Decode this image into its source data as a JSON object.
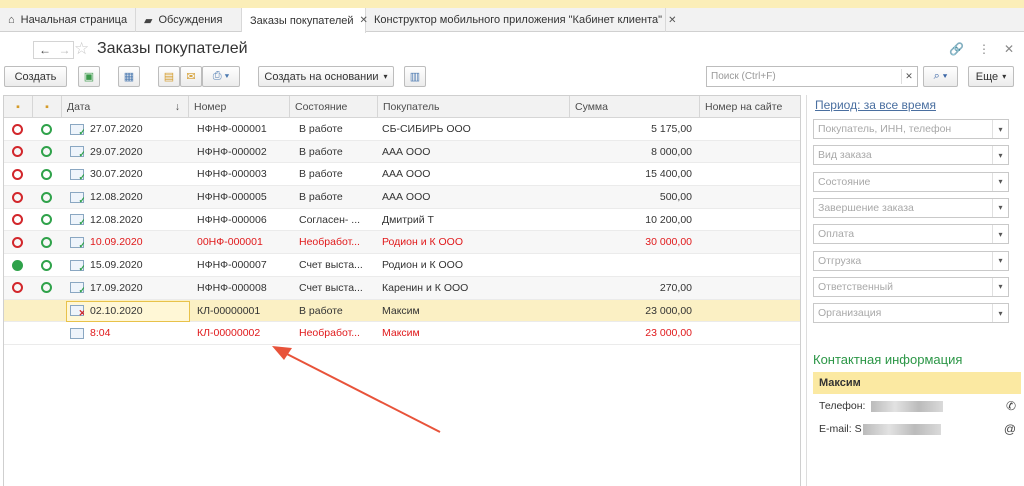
{
  "tabs": [
    {
      "label": "Начальная страница",
      "icon": "home-icon"
    },
    {
      "label": "Обсуждения",
      "icon": "chat-icon"
    },
    {
      "label": "Заказы покупателей",
      "active": true
    },
    {
      "label": "Конструктор мобильного приложения \"Кабинет клиента\""
    }
  ],
  "header": {
    "title": "Заказы покупателей"
  },
  "toolbar": {
    "create": "Создать",
    "create_based": "Создать на основании",
    "more": "Еще",
    "search_placeholder": "Поиск (Ctrl+F)"
  },
  "columns": {
    "date": "Дата",
    "sort_arrow": "↓",
    "number": "Номер",
    "state": "Состояние",
    "buyer": "Покупатель",
    "sum": "Сумма",
    "site_number": "Номер на сайте"
  },
  "rows": [
    {
      "date": "27.07.2020",
      "number": "НФНФ-000001",
      "state": "В работе",
      "buyer": "СБ-СИБИРЬ ООО",
      "sum": "5 175,00"
    },
    {
      "date": "29.07.2020",
      "number": "НФНФ-000002",
      "state": "В работе",
      "buyer": "ААА ООО",
      "sum": "8 000,00"
    },
    {
      "date": "30.07.2020",
      "number": "НФНФ-000003",
      "state": "В работе",
      "buyer": "ААА ООО",
      "sum": "15 400,00"
    },
    {
      "date": "12.08.2020",
      "number": "НФНФ-000005",
      "state": "В работе",
      "buyer": "ААА ООО",
      "sum": "500,00"
    },
    {
      "date": "12.08.2020",
      "number": "НФНФ-000006",
      "state": "Согласен- ...",
      "buyer": "Дмитрий Т",
      "sum": "10 200,00"
    },
    {
      "date": "10.09.2020",
      "number": "00НФ-000001",
      "state": "Необработ...",
      "buyer": "Родион и К ООО",
      "sum": "30 000,00"
    },
    {
      "date": "15.09.2020",
      "number": "НФНФ-000007",
      "state": "Счет выста...",
      "buyer": "Родион и К ООО",
      "sum": ""
    },
    {
      "date": "17.09.2020",
      "number": "НФНФ-000008",
      "state": "Счет выста...",
      "buyer": "Каренин и К ООО",
      "sum": "270,00"
    },
    {
      "date": "02.10.2020",
      "number": "КЛ-00000001",
      "state": "В работе",
      "buyer": "Максим",
      "sum": "23 000,00"
    },
    {
      "date": "8:04",
      "number": "КЛ-00000002",
      "state": "Необработ...",
      "buyer": "Максим",
      "sum": "23 000,00"
    }
  ],
  "side": {
    "period": "Период: за все время",
    "filters": [
      "Покупатель, ИНН, телефон",
      "Вид заказа",
      "Состояние",
      "Завершение заказа",
      "Оплата",
      "Отгрузка",
      "Ответственный",
      "Организация"
    ],
    "contact_title": "Контактная информация",
    "contact_name": "Максим",
    "phone_label": "Телефон:",
    "email_label": "E-mail: S"
  },
  "colors": {
    "accent_red": "#e0191b",
    "contact_green": "#2b9646",
    "selection": "#fbf0c4"
  }
}
